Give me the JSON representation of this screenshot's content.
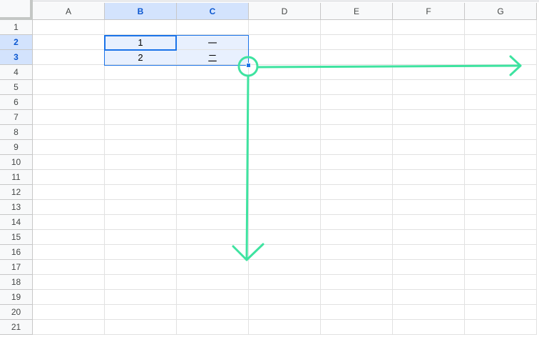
{
  "columns": [
    "A",
    "B",
    "C",
    "D",
    "E",
    "F",
    "G"
  ],
  "rows": [
    "1",
    "2",
    "3",
    "4",
    "5",
    "6",
    "7",
    "8",
    "9",
    "10",
    "11",
    "12",
    "13",
    "14",
    "15",
    "16",
    "17",
    "18",
    "19",
    "20",
    "21"
  ],
  "selected_columns": [
    "B",
    "C"
  ],
  "selected_rows": [
    "2",
    "3"
  ],
  "cells": [
    {
      "col": "B",
      "row": "2",
      "value": "1"
    },
    {
      "col": "C",
      "row": "2",
      "value": "一"
    },
    {
      "col": "B",
      "row": "3",
      "value": "2"
    },
    {
      "col": "C",
      "row": "3",
      "value": "二"
    }
  ],
  "annotation": {
    "color": "#3ee3a0",
    "shapes": [
      "circle-on-fill-handle",
      "arrow-right",
      "arrow-down"
    ]
  },
  "colors": {
    "selection": "#1a73e8",
    "range_fill": "#e8f0fe",
    "header_bg": "#f8f9fa",
    "grid": "#e1e1e1"
  }
}
